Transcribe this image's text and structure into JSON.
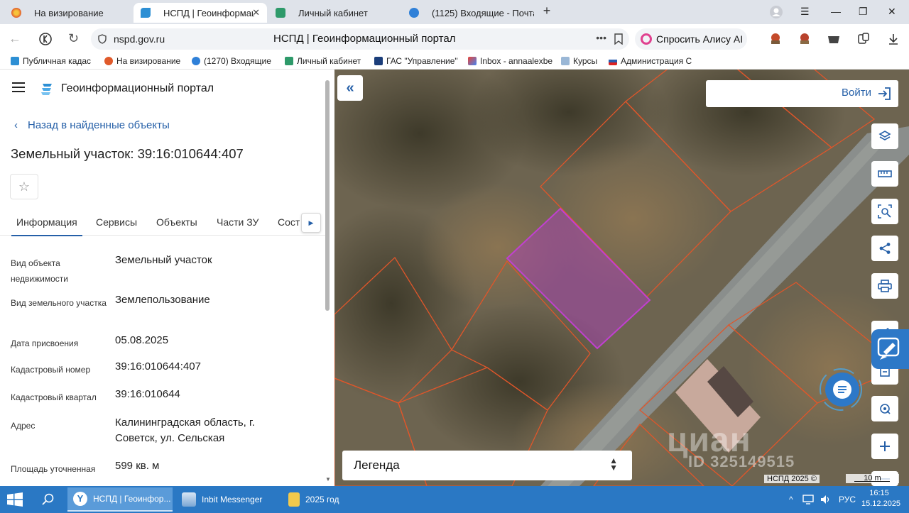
{
  "browser": {
    "tabs": [
      {
        "label": "На визирование",
        "icon": "yandex-ball-icon",
        "active": false
      },
      {
        "label": "НСПД | Геоинформаци",
        "icon": "nspd-logo-icon",
        "active": true
      },
      {
        "label": "Личный кабинет",
        "icon": "gosuslugi-icon",
        "active": false
      },
      {
        "label": "(1125) Входящие - Почта",
        "icon": "mail-icon",
        "active": false
      }
    ],
    "close_symbol": "✕",
    "new_tab_symbol": "+",
    "url": "nspd.gov.ru",
    "page_title": "НСПД | Геоинформационный портал",
    "alice_label": "Спросить Алису AI",
    "bookmarks": [
      {
        "label": "Публичная кадас",
        "icon": "nspd-logo-icon"
      },
      {
        "label": "На визирование",
        "icon": "yandex-ball-icon"
      },
      {
        "label": "(1270) Входящие",
        "icon": "mail-icon"
      },
      {
        "label": "Личный кабинет",
        "icon": "gosuslugi-icon"
      },
      {
        "label": "ГАС \"Управление\"",
        "icon": "gas-icon"
      },
      {
        "label": "Inbox - annaalexbe",
        "icon": "gmail-icon"
      },
      {
        "label": "Курсы",
        "icon": "courses-icon"
      },
      {
        "label": "Администрация С",
        "icon": "flag-icon"
      }
    ]
  },
  "panel": {
    "portal_title": "Геоинформационный портал",
    "back_link": "Назад в найденные объекты",
    "object_title": "Земельный участок: 39:16:010644:407",
    "tabs": [
      "Информация",
      "Сервисы",
      "Объекты",
      "Части ЗУ",
      "Сост"
    ],
    "properties": [
      {
        "label": "Вид объекта недвижимости",
        "value": "Земельный участок"
      },
      {
        "label": "Вид земельного участка",
        "value": "Землепользование"
      },
      {
        "label": "Дата присвоения",
        "value": "05.08.2025"
      },
      {
        "label": "Кадастровый номер",
        "value": "39:16:010644:407"
      },
      {
        "label": "Кадастровый квартал",
        "value": "39:16:010644"
      },
      {
        "label": "Адрес",
        "value": "Калининградская область, г. Советск, ул. Сельская"
      },
      {
        "label": "Площадь уточненная",
        "value": "599 кв. м"
      }
    ]
  },
  "map": {
    "login_label": "Войти",
    "legend_label": "Легенда",
    "copyright": "НСПД 2025 ©",
    "scale_label": "10 m",
    "watermark": "циан",
    "watermark_id": "ID 325149515",
    "tools": [
      "layers-icon",
      "ruler-icon",
      "search-area-icon",
      "share-icon",
      "print-icon",
      "draw-icon",
      "bookmark-icon",
      "geolocate-icon",
      "zoom-in-icon",
      "zoom-out-icon"
    ]
  },
  "taskbar": {
    "items": [
      {
        "label": "НСПД | Геоинфор...",
        "icon": "yandex-browser-icon",
        "active": true
      },
      {
        "label": "Inbit Messenger",
        "icon": "messenger-icon",
        "active": false
      },
      {
        "label": "2025 год",
        "icon": "folder-icon",
        "active": false
      }
    ],
    "language": "РУС",
    "time": "16:15",
    "date": "15.12.2025"
  },
  "colors": {
    "accent": "#2660a8",
    "parcel_border": "#e0562a",
    "selected_parcel": "#b03cc0",
    "taskbar": "#2a78c4"
  }
}
